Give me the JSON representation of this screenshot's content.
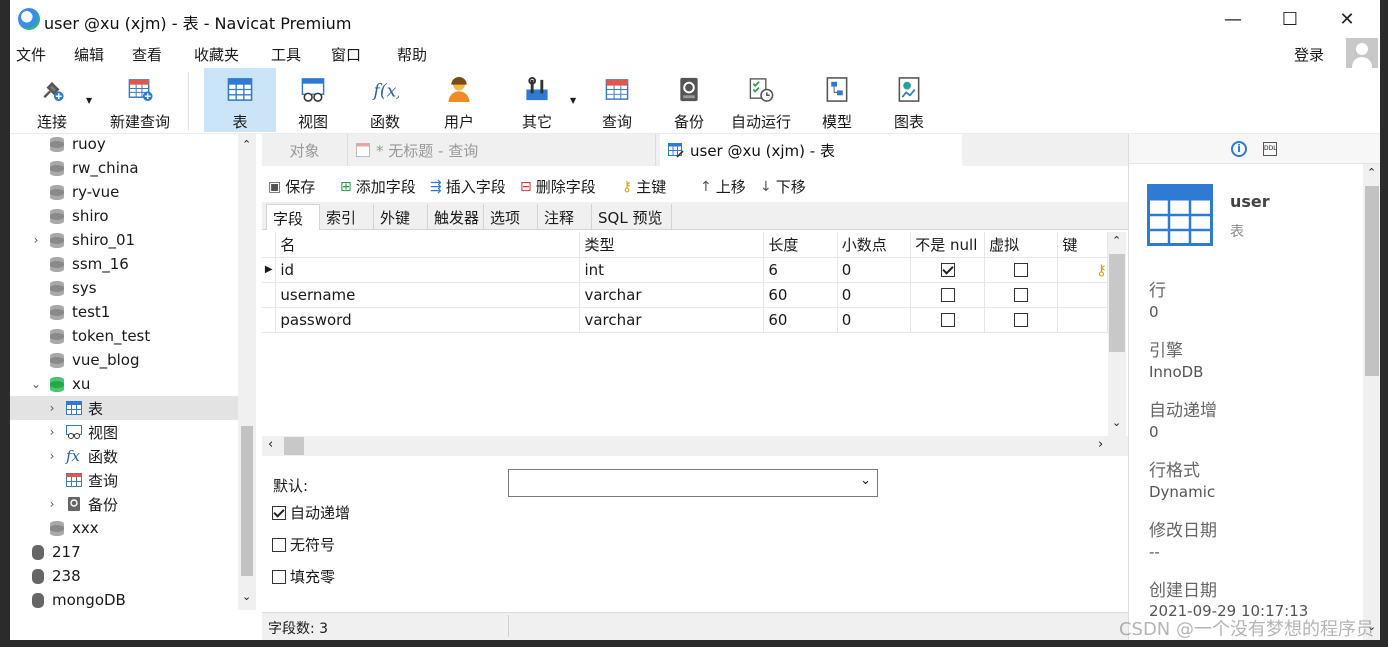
{
  "window": {
    "title": "user @xu (xjm) - 表 - Navicat Premium",
    "minimize": "—",
    "maximize": "☐",
    "close": "✕"
  },
  "menu": {
    "items": [
      "文件",
      "编辑",
      "查看",
      "收藏夹",
      "工具",
      "窗口",
      "帮助"
    ],
    "login": "登录"
  },
  "toolbar": {
    "items": [
      {
        "label": "连接",
        "icon": "connection-plug-icon"
      },
      {
        "label": "新建查询",
        "icon": "new-query-icon"
      },
      {
        "label": "表",
        "icon": "table-icon"
      },
      {
        "label": "视图",
        "icon": "view-icon"
      },
      {
        "label": "函数",
        "icon": "function-icon"
      },
      {
        "label": "用户",
        "icon": "user-icon"
      },
      {
        "label": "其它",
        "icon": "tools-icon"
      },
      {
        "label": "查询",
        "icon": "query-icon"
      },
      {
        "label": "备份",
        "icon": "backup-icon"
      },
      {
        "label": "自动运行",
        "icon": "auto-run-icon"
      },
      {
        "label": "模型",
        "icon": "model-icon"
      },
      {
        "label": "图表",
        "icon": "chart-icon"
      }
    ]
  },
  "tree": {
    "items": [
      {
        "label": "ruoy",
        "type": "db"
      },
      {
        "label": "rw_china",
        "type": "db"
      },
      {
        "label": "ry-vue",
        "type": "db"
      },
      {
        "label": "shiro",
        "type": "db"
      },
      {
        "label": "shiro_01",
        "type": "db",
        "expandable": true
      },
      {
        "label": "ssm_16",
        "type": "db"
      },
      {
        "label": "sys",
        "type": "db"
      },
      {
        "label": "test1",
        "type": "db"
      },
      {
        "label": "token_test",
        "type": "db"
      },
      {
        "label": "vue_blog",
        "type": "db"
      },
      {
        "label": "xu",
        "type": "db-open"
      },
      {
        "label": "表",
        "type": "tables",
        "selected": true
      },
      {
        "label": "视图",
        "type": "views"
      },
      {
        "label": "函数",
        "type": "functions"
      },
      {
        "label": "查询",
        "type": "queries"
      },
      {
        "label": "备份",
        "type": "backups"
      },
      {
        "label": "xxx",
        "type": "db"
      },
      {
        "label": "217",
        "type": "conn"
      },
      {
        "label": "238",
        "type": "conn"
      },
      {
        "label": "mongoDB",
        "type": "conn"
      }
    ]
  },
  "doc_tabs": {
    "objects": "对象",
    "untitled": "* 无标题 - 查询",
    "active": "user @xu (xjm) - 表"
  },
  "actions": {
    "save": "保存",
    "add_field": "添加字段",
    "insert_field": "插入字段",
    "delete_field": "删除字段",
    "primary_key": "主键",
    "move_up": "上移",
    "move_down": "下移"
  },
  "sub_tabs": [
    "字段",
    "索引",
    "外键",
    "触发器",
    "选项",
    "注释",
    "SQL 预览"
  ],
  "grid": {
    "columns": [
      "名",
      "类型",
      "长度",
      "小数点",
      "不是 null",
      "虚拟",
      "键"
    ],
    "rows": [
      {
        "name": "id",
        "type": "int",
        "length": "6",
        "decimals": "0",
        "not_null": true,
        "virtual": false,
        "key": true
      },
      {
        "name": "username",
        "type": "varchar",
        "length": "60",
        "decimals": "0",
        "not_null": false,
        "virtual": false,
        "key": false
      },
      {
        "name": "password",
        "type": "varchar",
        "length": "60",
        "decimals": "0",
        "not_null": false,
        "virtual": false,
        "key": false
      }
    ]
  },
  "props": {
    "default_label": "默认:",
    "default_value": "",
    "auto_increment": {
      "label": "自动递增",
      "checked": true
    },
    "unsigned": {
      "label": "无符号",
      "checked": false
    },
    "zerofill": {
      "label": "填充零",
      "checked": false
    }
  },
  "status": {
    "field_count": "字段数: 3"
  },
  "info": {
    "name": "user",
    "kind": "表",
    "fields": [
      {
        "label": "行",
        "value": "0"
      },
      {
        "label": "引擎",
        "value": "InnoDB"
      },
      {
        "label": "自动递增",
        "value": "0"
      },
      {
        "label": "行格式",
        "value": "Dynamic"
      },
      {
        "label": "修改日期",
        "value": "--"
      },
      {
        "label": "创建日期",
        "value": "2021-09-29 10:17:13"
      }
    ]
  },
  "watermark": "CSDN @一个没有梦想的程序员"
}
